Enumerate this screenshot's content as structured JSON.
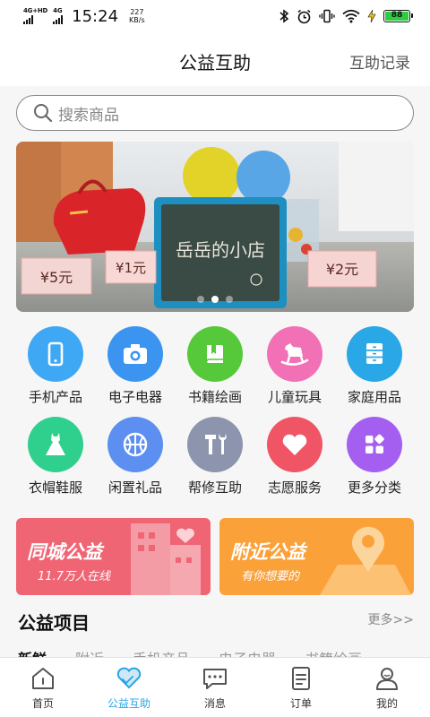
{
  "status_bar": {
    "network1": "4G+HD",
    "network2": "4G",
    "time": "15:24",
    "speed_value": "227",
    "speed_unit": "KB/s",
    "battery": "88"
  },
  "header": {
    "title": "公益互助",
    "record_link": "互助记录"
  },
  "search": {
    "placeholder": "搜索商品"
  },
  "banner": {
    "price_tags": [
      "¥5元",
      "¥1元",
      "¥2元"
    ],
    "board_text": "岳岳的小店",
    "dot_count": 3,
    "active_dot": 2
  },
  "categories": [
    {
      "label": "手机产品",
      "icon": "phone-icon",
      "color": "#3fa8f4"
    },
    {
      "label": "电子电器",
      "icon": "camera-icon",
      "color": "#3b95f0"
    },
    {
      "label": "书籍绘画",
      "icon": "book-icon",
      "color": "#55c93a"
    },
    {
      "label": "儿童玩具",
      "icon": "rocking-horse-icon",
      "color": "#f271b6"
    },
    {
      "label": "家庭用品",
      "icon": "cabinet-icon",
      "color": "#2aa7e6"
    },
    {
      "label": "衣帽鞋服",
      "icon": "dress-icon",
      "color": "#2fd08e"
    },
    {
      "label": "闲置礼品",
      "icon": "basketball-icon",
      "color": "#5c8ff0"
    },
    {
      "label": "帮修互助",
      "icon": "tools-icon",
      "color": "#8c95ad"
    },
    {
      "label": "志愿服务",
      "icon": "heart-icon",
      "color": "#f05565"
    },
    {
      "label": "更多分类",
      "icon": "grid-icon",
      "color": "#a55ff0"
    }
  ],
  "promos": [
    {
      "title": "同城公益",
      "subtitle": "11.7万人在线",
      "color": "#f06574"
    },
    {
      "title": "附近公益",
      "subtitle": "有你想要的",
      "color": "#fba13a"
    }
  ],
  "section": {
    "title": "公益项目",
    "more": "更多>>",
    "tabs": [
      "新鲜",
      "附近",
      "手机产品",
      "电子电器",
      "书籍绘画"
    ]
  },
  "tabbar": [
    {
      "label": "首页",
      "icon": "home-icon"
    },
    {
      "label": "公益互助",
      "icon": "heart-hands-icon"
    },
    {
      "label": "消息",
      "icon": "message-icon"
    },
    {
      "label": "订单",
      "icon": "order-icon"
    },
    {
      "label": "我的",
      "icon": "user-icon"
    }
  ],
  "colors": {
    "accent": "#2aa4e6"
  }
}
